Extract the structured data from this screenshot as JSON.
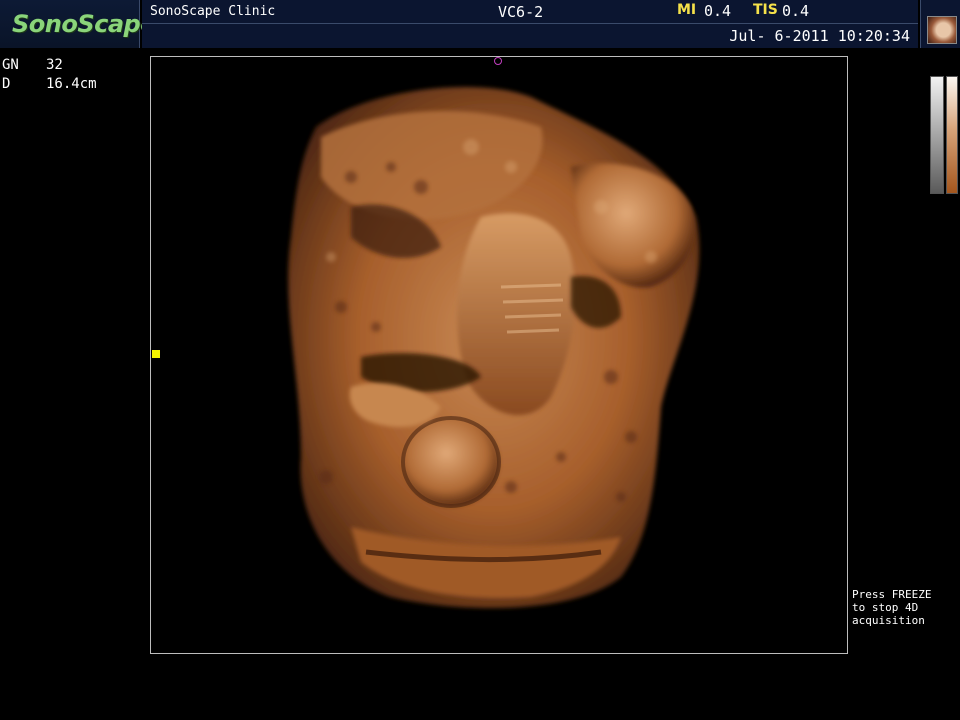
{
  "header": {
    "brand": "SonoScape",
    "clinic": "SonoScape Clinic",
    "probe": "VC6-2",
    "mi_label": "MI",
    "mi_value": "0.4",
    "tis_label": "TIS",
    "tis_value": "0.4",
    "datetime": "Jul- 6-2011 10:20:34"
  },
  "params": [
    {
      "key": "GN",
      "value": "32"
    },
    {
      "key": "D",
      "value": "16.4cm"
    }
  ],
  "status_hint": "Press FREEZE\nto stop 4D\nacquisition",
  "colors": {
    "header_bg": "#0b1530",
    "logo_green": "#8ad47a",
    "label_yellow": "#f5e14a",
    "tissue_main": "#b06a35",
    "tissue_light": "#d79b64",
    "tissue_dark": "#4a2410",
    "roi_marker": "#c23fbf",
    "focus_marker": "#f2f200"
  }
}
